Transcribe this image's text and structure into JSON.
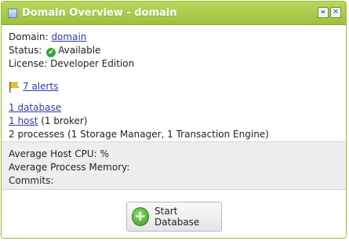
{
  "header": {
    "title": "Domain Overview - domain",
    "collapse_glyph": "«",
    "close_glyph": "✕",
    "accent_color": "#a6c64a",
    "icons": [
      "window-icon",
      "collapse-icon",
      "close-icon"
    ]
  },
  "info": {
    "domain_label": "Domain:",
    "domain_link": "domain",
    "status_label": "Status:",
    "status_value": "Available",
    "status_icon": "check-circle-icon",
    "license_label": "License:",
    "license_value": "Developer Edition"
  },
  "alerts": {
    "icon": "flag-icon",
    "link": "7 alerts"
  },
  "resources": {
    "database_link": "1 database",
    "host_link": "1 host",
    "host_suffix": "(1 broker)",
    "processes_text": "2 processes (1 Storage Manager, 1 Transaction Engine)"
  },
  "metrics": {
    "cpu_label": "Average Host CPU: %",
    "memory_label": "Average Process Memory:",
    "commits_label": "Commits:"
  },
  "actions": {
    "start_label": "Start Database",
    "start_icon": "add-circle-icon"
  }
}
